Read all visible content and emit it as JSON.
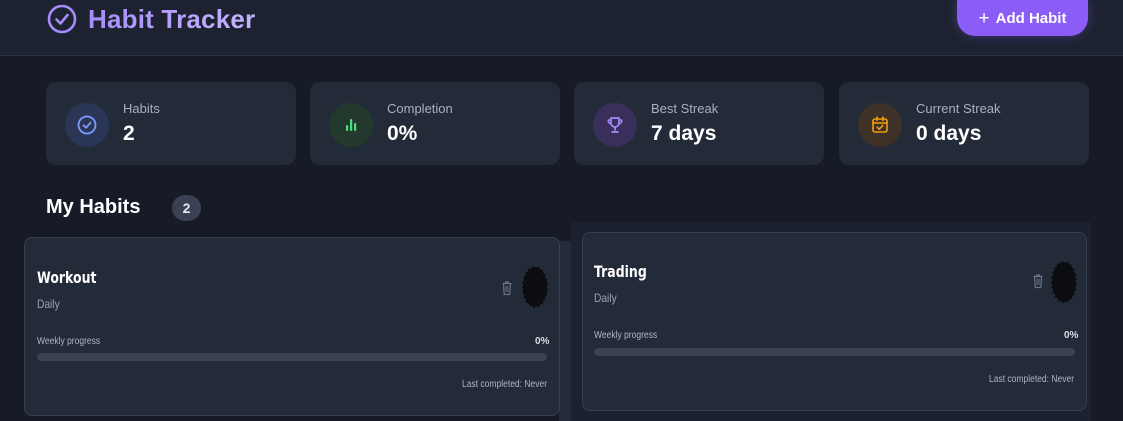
{
  "header": {
    "title": "Habit Tracker",
    "add_button": "Add Habit"
  },
  "stats": [
    {
      "label": "Habits",
      "value": "2",
      "icon": "check-circle-icon",
      "color": "#7c9cff"
    },
    {
      "label": "Completion",
      "value": "0%",
      "icon": "bar-chart-icon",
      "color": "#4ade80"
    },
    {
      "label": "Best Streak",
      "value": "7 days",
      "icon": "trophy-icon",
      "color": "#a78bfa"
    },
    {
      "label": "Current Streak",
      "value": "0 days",
      "icon": "calendar-check-icon",
      "color": "#f59e0b"
    }
  ],
  "habits_section": {
    "title": "My Habits",
    "count": "2"
  },
  "habits": [
    {
      "name": "Workout",
      "frequency": "Daily",
      "progress_label": "Weekly progress",
      "progress_value": "0%",
      "progress": 0,
      "last_completed": "Last completed: Never"
    },
    {
      "name": "Trading",
      "frequency": "Daily",
      "progress_label": "Weekly progress",
      "progress_value": "0%",
      "progress": 0,
      "last_completed": "Last completed: Never"
    }
  ],
  "colors": {
    "accent": "#8b5cf6",
    "background": "#161b27",
    "card": "#232a38"
  }
}
